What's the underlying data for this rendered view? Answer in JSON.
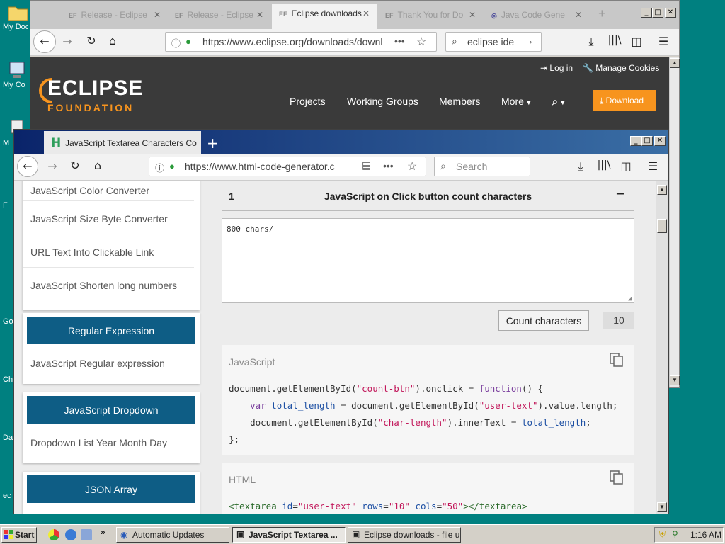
{
  "desktop": {
    "icons": [
      {
        "label": "My Doc"
      },
      {
        "label": "My Co"
      },
      {
        "label": "M"
      },
      {
        "label": "F"
      },
      {
        "label": "Go"
      },
      {
        "label": "Ch"
      },
      {
        "label": "Da"
      },
      {
        "label": "ec"
      }
    ]
  },
  "back_window": {
    "tabs": [
      {
        "badge": "EF",
        "label": "Release - Eclipse"
      },
      {
        "badge": "EF",
        "label": "Release - Eclipse"
      },
      {
        "badge": "EF",
        "label": "Eclipse downloads"
      },
      {
        "badge": "EF",
        "label": "Thank You for Do"
      },
      {
        "badge": "",
        "label": "Java Code Gene"
      }
    ],
    "url": "https://www.eclipse.org/downloads/downl",
    "search_value": "eclipse ide",
    "header": {
      "logo_name": "ECLIPSE",
      "logo_sub": "FOUNDATION",
      "login": "Log in",
      "manage_cookies": "Manage Cookies",
      "nav": [
        "Projects",
        "Working Groups",
        "Members",
        "More"
      ],
      "download": "Download"
    }
  },
  "front_window": {
    "tab_label": "JavaScript Textarea Characters Co",
    "url": "https://www.html-code-generator.com",
    "search_placeholder": "Search",
    "sidebar": {
      "links_top": [
        "JavaScript Color Converter",
        "JavaScript Size Byte Converter",
        "URL Text Into Clickable Link",
        "JavaScript Shorten long numbers"
      ],
      "sections": [
        {
          "heading": "Regular Expression",
          "links": [
            "JavaScript Regular expression"
          ]
        },
        {
          "heading": "JavaScript Dropdown",
          "links": [
            "Dropdown List Year Month Day"
          ]
        },
        {
          "heading": "JSON Array",
          "links": []
        }
      ]
    },
    "main": {
      "section_number": "1",
      "section_title": "JavaScript on Click button count characters",
      "toggle": "−",
      "textarea_value": "800 chars/",
      "count_button": "Count characters",
      "count_value": "10",
      "js_label": "JavaScript",
      "html_label": "HTML",
      "js_code": {
        "line1_a": "document.getElementById(",
        "line1_s": "\"count-btn\"",
        "line1_b": ").onclick = ",
        "line1_k": "function",
        "line1_c": "() {",
        "line2_k": "var",
        "line2_v": "total_length",
        "line2_a": " = document.getElementById(",
        "line2_s": "\"user-text\"",
        "line2_b": ").value.length;",
        "line3_a": "document.getElementById(",
        "line3_s": "\"char-length\"",
        "line3_b": ").innerText = ",
        "line3_v": "total_length",
        "line3_c": ";",
        "line4": "};"
      },
      "html_code": {
        "tag_open": "<textarea",
        "attr1": "id",
        "val1": "\"user-text\"",
        "attr2": "rows",
        "val2": "\"10\"",
        "attr3": "cols",
        "val3": "\"50\"",
        "tag_close": "></textarea>"
      }
    }
  },
  "taskbar": {
    "start": "Start",
    "tasks": [
      {
        "label": "Automatic Updates",
        "active": false
      },
      {
        "label": "JavaScript Textarea ...",
        "active": true
      },
      {
        "label": "Eclipse downloads - file u...",
        "active": false
      }
    ],
    "clock": "1:16 AM"
  }
}
